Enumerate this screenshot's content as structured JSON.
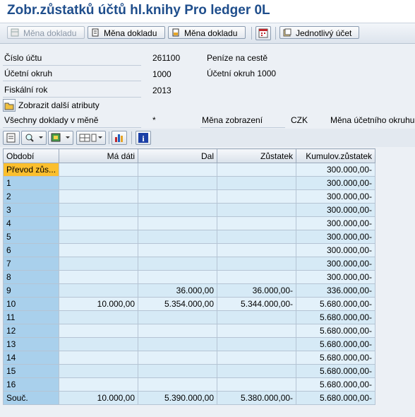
{
  "title": "Zobr.zůstatků účtů hl.knihy Pro ledger 0L",
  "toolbar": {
    "btn1": "Měna dokladu",
    "btn2": "Měna dokladu",
    "btn3": "Měna dokladu",
    "btn4": "Jednotlivý účet"
  },
  "header": {
    "account_label": "Číslo účtu",
    "account_value": "261100",
    "account_desc": "Peníze na cestě",
    "company_label": "Účetní okruh",
    "company_value": "1000",
    "company_desc": "Účetní okruh 1000",
    "fiscal_label": "Fiskální rok",
    "fiscal_value": "2013",
    "more_attrs": "Zobrazit další atributy",
    "all_docs_label": "Všechny doklady v měně",
    "all_docs_value": "*",
    "disp_curr_label": "Měna zobrazení",
    "disp_curr_value": "CZK",
    "cc_curr_label": "Měna účetního okruhu"
  },
  "table": {
    "columns": [
      "Období",
      "Má dáti",
      "Dal",
      "Zůstatek",
      "Kumulov.zůstatek"
    ],
    "rows": [
      [
        "Převod zůs...",
        "",
        "",
        "",
        "300.000,00-"
      ],
      [
        "1",
        "",
        "",
        "",
        "300.000,00-"
      ],
      [
        "2",
        "",
        "",
        "",
        "300.000,00-"
      ],
      [
        "3",
        "",
        "",
        "",
        "300.000,00-"
      ],
      [
        "4",
        "",
        "",
        "",
        "300.000,00-"
      ],
      [
        "5",
        "",
        "",
        "",
        "300.000,00-"
      ],
      [
        "6",
        "",
        "",
        "",
        "300.000,00-"
      ],
      [
        "7",
        "",
        "",
        "",
        "300.000,00-"
      ],
      [
        "8",
        "",
        "",
        "",
        "300.000,00-"
      ],
      [
        "9",
        "",
        "36.000,00",
        "36.000,00-",
        "336.000,00-"
      ],
      [
        "10",
        "10.000,00",
        "5.354.000,00",
        "5.344.000,00-",
        "5.680.000,00-"
      ],
      [
        "11",
        "",
        "",
        "",
        "5.680.000,00-"
      ],
      [
        "12",
        "",
        "",
        "",
        "5.680.000,00-"
      ],
      [
        "13",
        "",
        "",
        "",
        "5.680.000,00-"
      ],
      [
        "14",
        "",
        "",
        "",
        "5.680.000,00-"
      ],
      [
        "15",
        "",
        "",
        "",
        "5.680.000,00-"
      ],
      [
        "16",
        "",
        "",
        "",
        "5.680.000,00-"
      ],
      [
        "Souč.",
        "10.000,00",
        "5.390.000,00",
        "5.380.000,00-",
        "5.680.000,00-"
      ]
    ]
  }
}
